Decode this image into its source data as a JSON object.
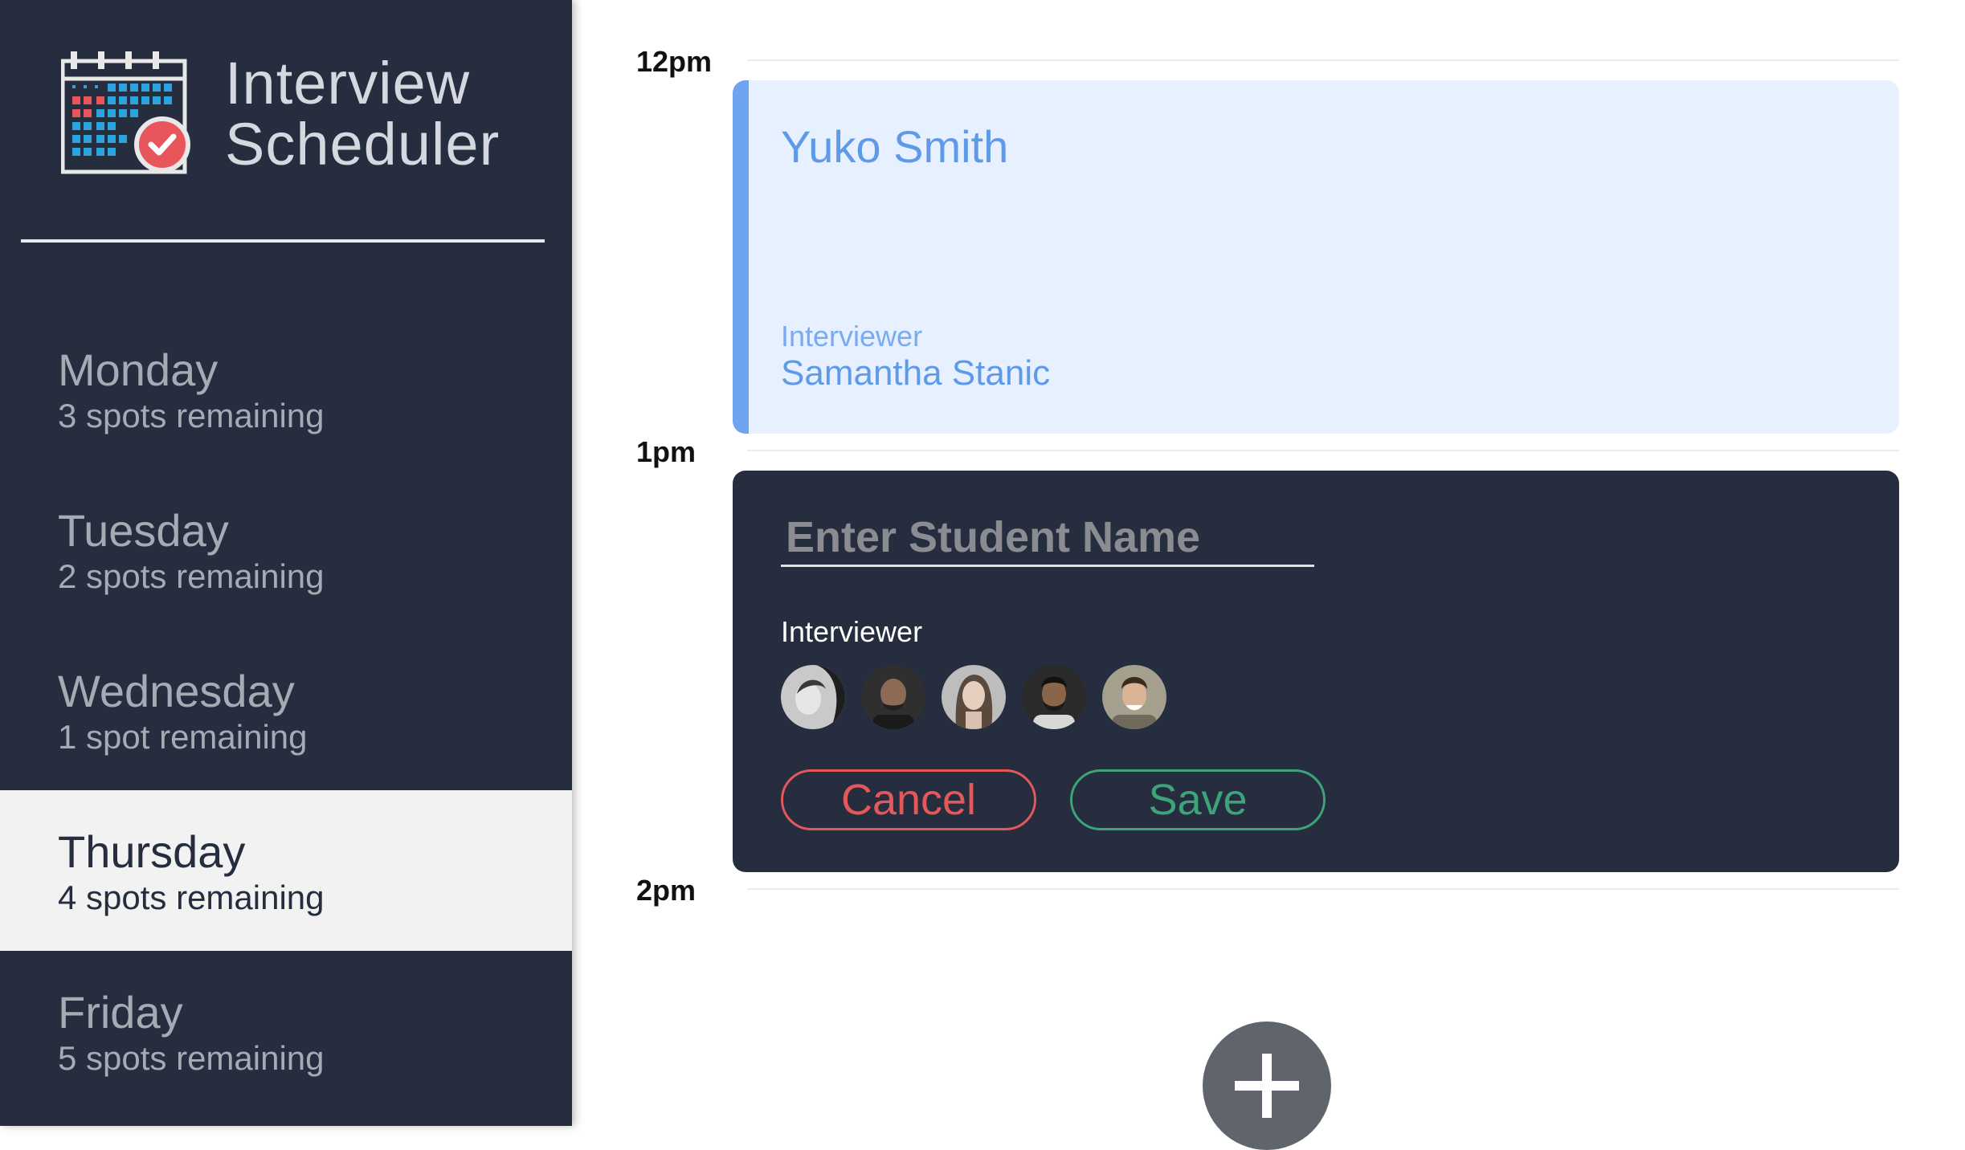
{
  "app": {
    "title_line1": "Interview",
    "title_line2": "Scheduler",
    "logo_icon": "calendar-check-icon"
  },
  "sidebar": {
    "days": [
      {
        "name": "Monday",
        "spots": "3 spots remaining",
        "selected": false
      },
      {
        "name": "Tuesday",
        "spots": "2 spots remaining",
        "selected": false
      },
      {
        "name": "Wednesday",
        "spots": "1 spot remaining",
        "selected": false
      },
      {
        "name": "Thursday",
        "spots": "4 spots remaining",
        "selected": true
      },
      {
        "name": "Friday",
        "spots": "5 spots remaining",
        "selected": false
      }
    ]
  },
  "schedule": {
    "times": [
      "12pm",
      "1pm",
      "2pm"
    ],
    "appointment": {
      "student": "Yuko Smith",
      "interviewer_label": "Interviewer",
      "interviewer_name": "Samantha Stanic"
    },
    "form": {
      "name_placeholder": "Enter Student Name",
      "name_value": "",
      "interviewer_label": "Interviewer",
      "interviewers": [
        "avatar-1",
        "avatar-2",
        "avatar-3",
        "avatar-4",
        "avatar-5"
      ],
      "cancel_label": "Cancel",
      "save_label": "Save"
    },
    "add_icon": "plus-icon"
  },
  "colors": {
    "sidebar_bg": "#252d3e",
    "selected_bg": "#f2f2f2",
    "appointment_bg": "#e7f0fe",
    "appointment_accent": "#6ea4ef",
    "cancel": "#e5585a",
    "save": "#3ea37a",
    "add_button": "#60646c"
  }
}
